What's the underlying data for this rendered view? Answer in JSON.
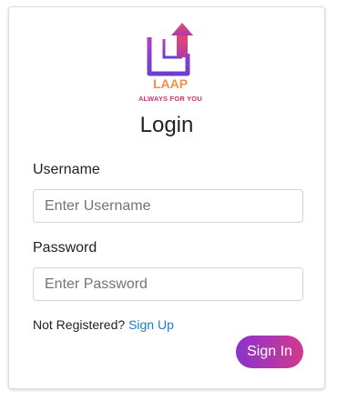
{
  "logo": {
    "name": "LAAP",
    "tagline": "ALWAYS FOR YOU"
  },
  "login": {
    "title": "Login",
    "username_label": "Username",
    "username_placeholder": "Enter Username",
    "username_value": "",
    "password_label": "Password",
    "password_placeholder": "Enter Password",
    "password_value": "",
    "not_registered_text": "Not Registered?",
    "signup_link": "Sign Up",
    "signin_button": "Sign In"
  },
  "colors": {
    "accent_start": "#8b33cc",
    "accent_end": "#d13a8e",
    "link": "#1e7ec8",
    "logo_name": "#f0904a",
    "logo_tagline": "#d4306a"
  }
}
